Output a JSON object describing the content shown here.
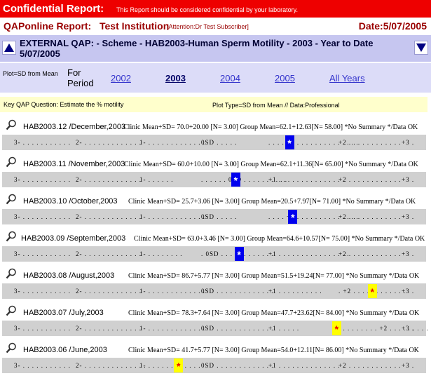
{
  "banner": {
    "label": "Confidential Report:",
    "message": "This Report should be considered confidential by your laboratory."
  },
  "header": {
    "title": "QAPonline Report:",
    "institution": "Test Institution",
    "attention": "[Attention:Dr Test Subscriber]",
    "date": "Date:5/07/2005"
  },
  "scheme": {
    "text": "EXTERNAL QAP: - Scheme - HAB2003-Human Sperm Motility - 2003 - Year to Date 5/07/2005",
    "up_icon": "up-triangle-icon",
    "down_icon": "down-triangle-icon"
  },
  "year_bar": {
    "plot_label": "Plot=SD from Mean",
    "period_label": "For Period",
    "years": [
      "2002",
      "2003",
      "2004",
      "2005",
      "All Years"
    ],
    "selected": "2003"
  },
  "question": {
    "text": "Key QAP Question: Estimate the % motility",
    "plot_type": "Plot Type=SD from Mean // Data:Professional"
  },
  "colors": {
    "banner": "#ee0000",
    "marker_in": "#0000ee",
    "marker_out": "#ffff00"
  },
  "rows": [
    {
      "period": "HAB2003.12 /December,2003",
      "stats": "Clinic Mean+SD= 70.0+20.00 [N= 3.00] Group Mean=62.1+12.63[N= 58.00] *No Summary */Data OK",
      "sd": 0.6,
      "marker_color": "blue",
      "ticks": [
        "3- . . . . . . . . . . .",
        "2- . . . . . . . . . . . . .",
        "1- . . . . . . . . . . . . .",
        "0SD . . . . .",
        ". . . . +1 . . . . . . . . . . . . . .",
        "+2 . . . . . . . . . . . .",
        "+3 ."
      ]
    },
    {
      "period": "HAB2003.11 /November,2003",
      "stats": "Clinic Mean+SD= 60.0+10.00 [N= 3.00] Group Mean=62.1+11.36[N= 65.00] *No Summary */Data OK",
      "sd": -0.2,
      "marker_color": "blue",
      "ticks": [
        "3- . . . . . . . . . . .",
        "2- . . . . . . . . . . . . .",
        "1- . . . . . .",
        ". . . . . . 0SD . . . . . . . . . .",
        "+1 . . . . . . . . . . . . . . .",
        "+2 . . . . . . . . . . . .",
        "+3 ."
      ]
    },
    {
      "period": "HAB2003.10 /October,2003",
      "stats": "Clinic Mean+SD= 25.7+3.06 [N= 3.00] Group Mean=20.5+7.97[N= 71.00] *No Summary */Data OK",
      "sd": 0.65,
      "marker_color": "blue",
      "ticks": [
        "3- . . . . . . . . . . .",
        "2- . . . . . . . . . . . . .",
        "1- . . . . . . . . . . . . .",
        "0SD . . . . .",
        ". . . . +1 . . . . . . . . . . . . . .",
        "+2 . . . . . . . . . . . .",
        "+3 ."
      ]
    },
    {
      "period": "HAB2003.09 /September,2003",
      "stats": "Clinic Mean+SD= 63.0+3.46 [N= 3.00] Group Mean=64.6+10.57[N= 75.00] *No Summary */Data OK",
      "sd": -0.15,
      "marker_color": "blue",
      "ticks": [
        "3- . . . . . . . . . . .",
        "2- . . . . . . . . . . . . .",
        "1- . . . . . . . .",
        ". 0SD . . . . . . . . . . . .",
        "+1 . . . . . . . . . . . . . . . .",
        "+2 . . . . . . . . . . . .",
        "+3 ."
      ]
    },
    {
      "period": "HAB2003.08 /August,2003",
      "stats": "Clinic Mean+SD= 86.7+5.77 [N= 3.00] Group Mean=51.5+19.24[N= 77.00] *No Summary */Data OK",
      "sd": 1.83,
      "marker_color": "yellow",
      "ticks": [
        "3- . . . . . . . . . . .",
        "2- . . . . . . . . . . . . .",
        "1- . . . . . . . . . . . . .",
        "0SD . . . . . . . . . . . . .",
        "+1 . . . . . . . . . .",
        ". +2 . . . . . . . . . . . .",
        "+3 ."
      ]
    },
    {
      "period": "HAB2003.07 /July,2003",
      "stats": "Clinic Mean+SD= 78.3+7.64 [N= 3.00] Group Mean=47.7+23.62[N= 84.00] *No Summary */Data OK",
      "sd": 1.3,
      "marker_color": "yellow",
      "ticks": [
        "3- . . . . . . . . . . .",
        "2- . . . . . . . . . . . . .",
        "1- . . . . . . . . . . . . .",
        "0SD . . . . . . . . . . . . .",
        "+1 . . . . .",
        ". . . . . . . . . +2 . . . . . . . . . . . .",
        "+3 ."
      ]
    },
    {
      "period": "HAB2003.06 /June,2003",
      "stats": "Clinic Mean+SD= 41.7+5.77 [N= 3.00] Group Mean=54.0+12.11[N= 86.00] *No Summary */Data OK",
      "sd": -1.05,
      "marker_color": "yellow",
      "ticks": [
        "3- . . . . . . . . . . .",
        "2- . . . . . . . . . . . . . .",
        "1- . . . . . . . . . . . .",
        "0SD . . . . . . . . . . . . .",
        "+1 . . . . . . . . . . . . . . .",
        "+2 . . . . . . . . . . . .",
        "+3 ."
      ]
    }
  ]
}
